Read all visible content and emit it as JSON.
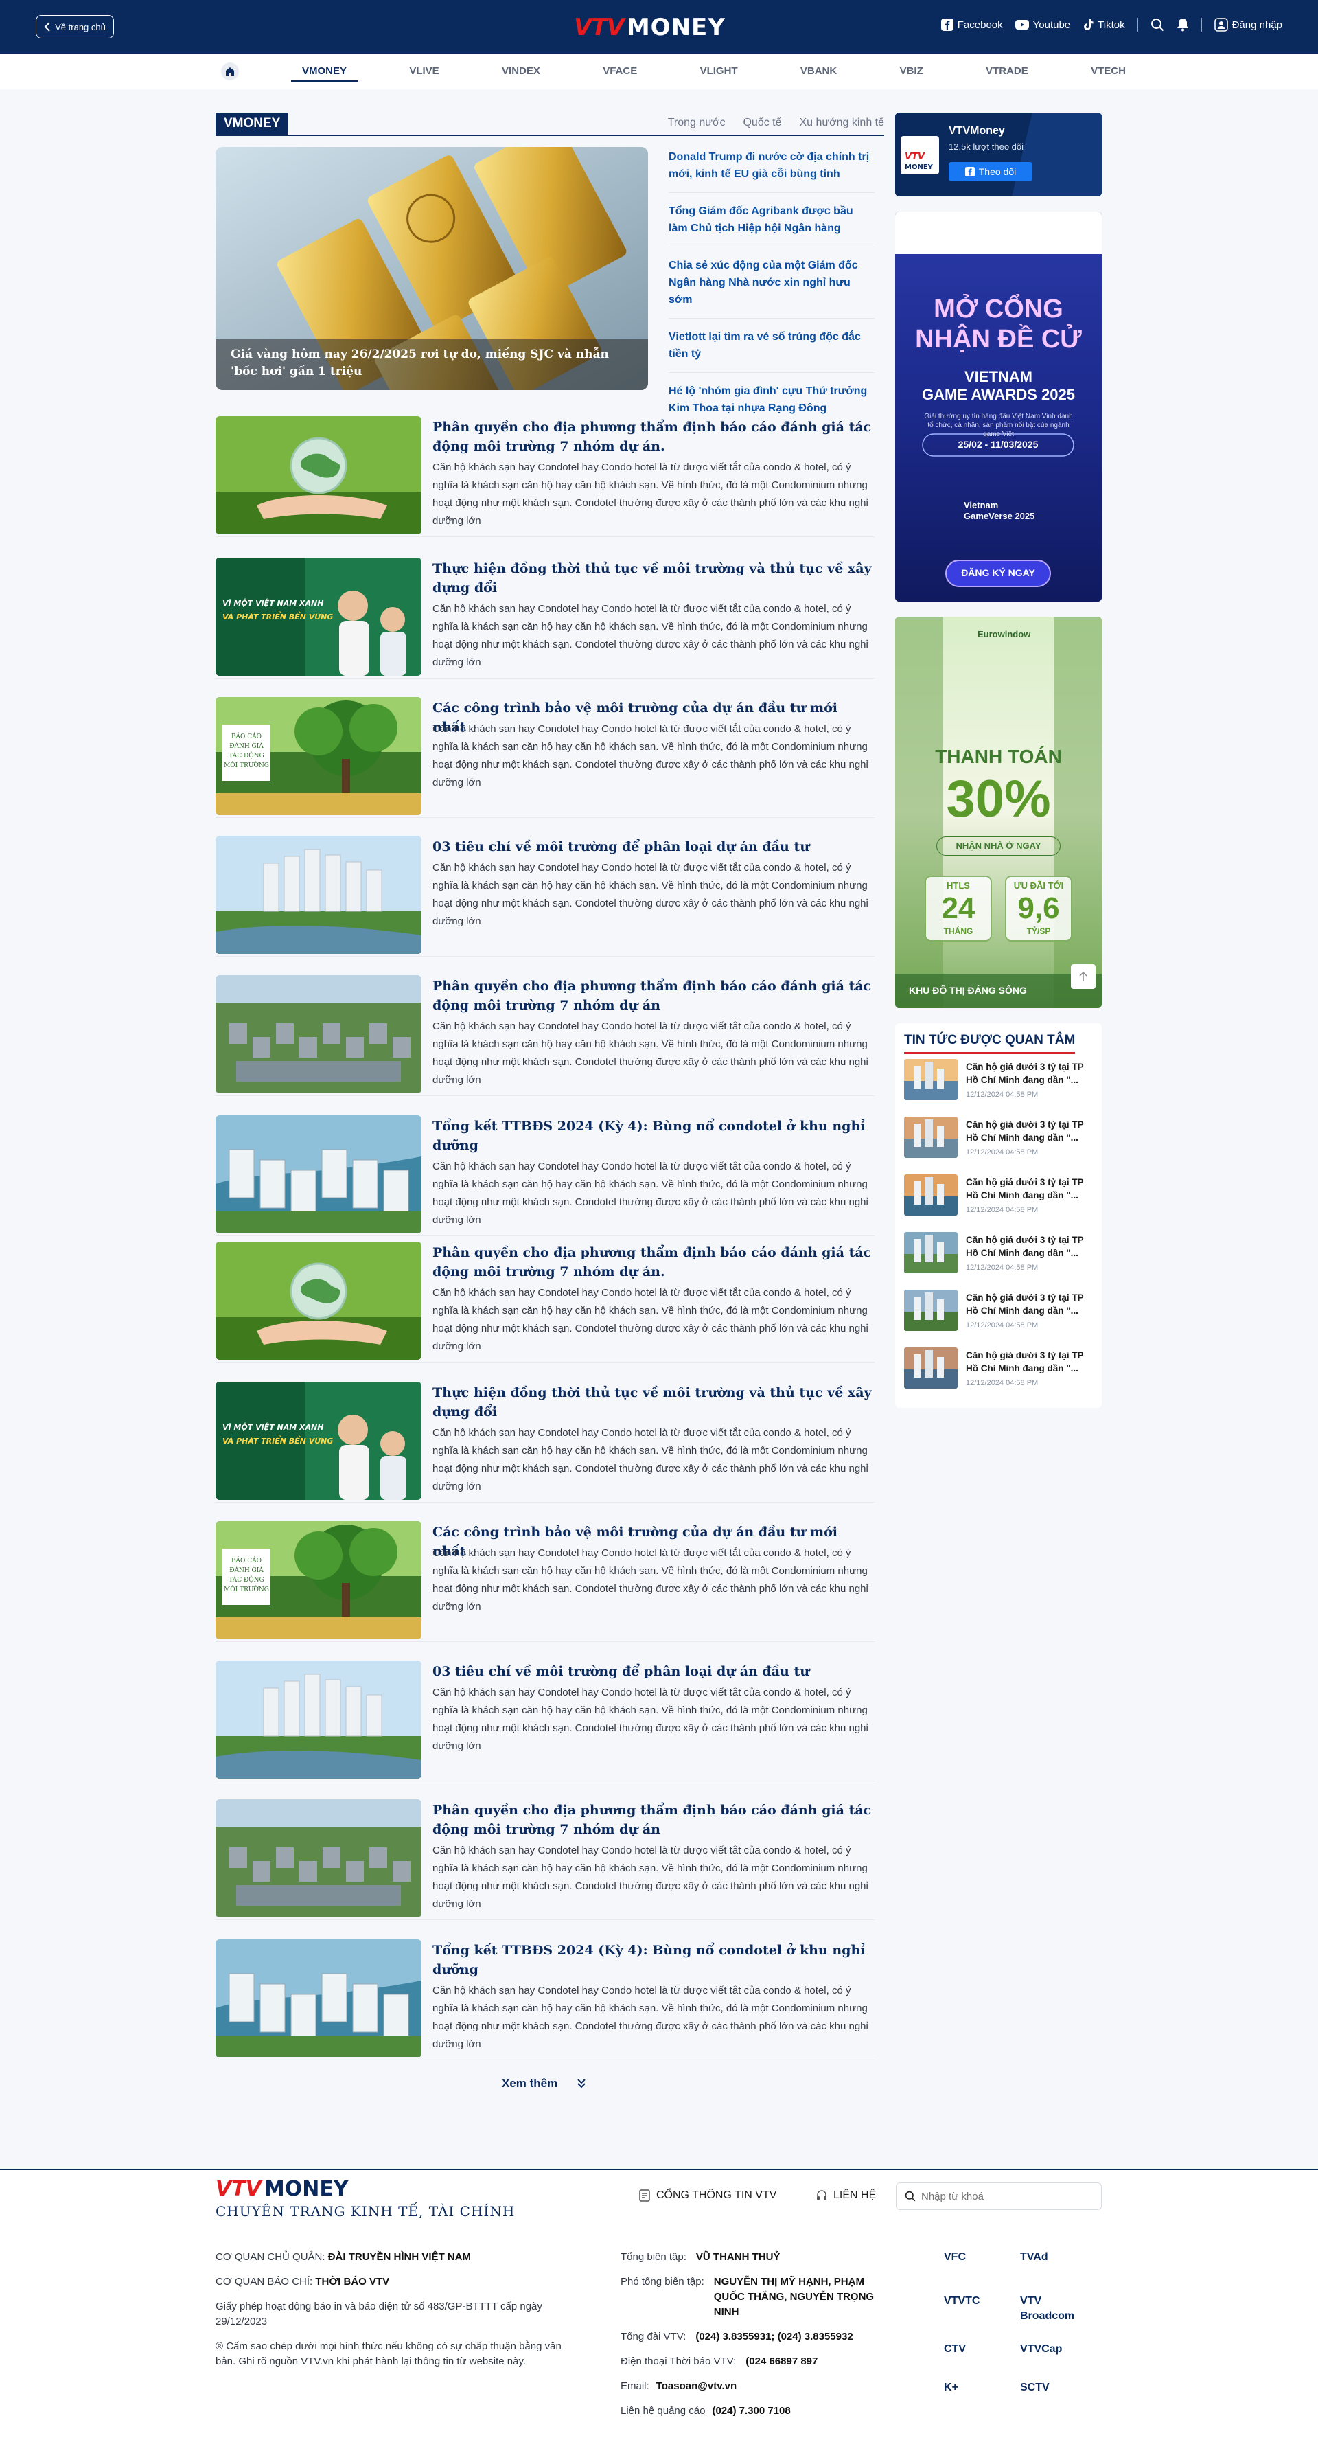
{
  "header": {
    "back_label": "Về trang chủ",
    "logo_vtv": "VTV",
    "logo_money": "MONEY",
    "social": [
      "Facebook",
      "Youtube",
      "Tiktok"
    ],
    "login_label": "Đăng nhập"
  },
  "nav": [
    "VMONEY",
    "VLIVE",
    "VINDEX",
    "VFACE",
    "VLIGHT",
    "VBANK",
    "VBIZ",
    "VTRADE",
    "VTECH"
  ],
  "section": {
    "tag": "VMONEY",
    "tabs": [
      "Trong nước",
      "Quốc tế",
      "Xu hướng kinh tế"
    ]
  },
  "hero": {
    "caption": "Giá vàng hôm nay 26/2/2025 rơi tự do, miếng SJC và nhẫn 'bốc hơi' gần 1 triệu"
  },
  "side_links": [
    "Donald Trump đi nước cờ địa chính trị mới, kinh tế EU già cỗi bùng tỉnh",
    "Tổng Giám đốc Agribank được bầu làm Chủ tịch Hiệp hội Ngân hàng",
    "Chia sẻ xúc động của một Giám đốc Ngân hàng Nhà nước xin nghỉ hưu sớm",
    "Vietlott lại tìm ra vé số trúng độc đắc tiền tỷ",
    "Hé lộ 'nhóm gia đình' cựu Thứ trưởng Kim Thoa tại nhựa Rạng Đông"
  ],
  "article_desc": "Căn hộ khách sạn hay Condotel hay Condo hotel là từ được viết tắt của condo & hotel, có ý nghĩa là khách sạn căn hộ hay căn hộ khách sạn. Về hình thức, đó là một Condominium nhưng hoạt động như một khách sạn. Condotel thường được xây ở các thành phố lớn và các khu nghỉ dưỡng lớn",
  "articles": [
    {
      "title": "Phân quyền cho địa phương thẩm định báo cáo đánh giá tác động môi trường 7 nhóm dự án.",
      "img": "globe"
    },
    {
      "title": "Thực hiện đồng thời thủ tục về môi trường và thủ tục về xây dựng đổi",
      "img": "green-people"
    },
    {
      "title": "Các công trình bảo vệ môi trường của dự án đầu tư mới nhất",
      "img": "tree"
    },
    {
      "title": "03 tiêu chí về môi trường để phân loại dự án đầu tư",
      "img": "city"
    },
    {
      "title": "Phân quyền cho địa phương thẩm định báo cáo đánh giá tác động môi trường 7 nhóm dự án",
      "img": "industrial"
    },
    {
      "title": "Tổng kết TTBĐS 2024 (Kỳ 4): Bùng nổ condotel ở khu nghỉ dưỡng",
      "img": "resort"
    },
    {
      "title": "Phân quyền cho địa phương thẩm định báo cáo đánh giá tác động môi trường 7 nhóm dự án.",
      "img": "globe"
    },
    {
      "title": "Thực hiện đồng thời thủ tục về môi trường và thủ tục về xây dựng đổi",
      "img": "green-people"
    },
    {
      "title": "Các công trình bảo vệ môi trường của dự án đầu tư mới nhất",
      "img": "tree"
    },
    {
      "title": "03 tiêu chí về môi trường để phân loại dự án đầu tư",
      "img": "city"
    },
    {
      "title": "Phân quyền cho địa phương thẩm định báo cáo đánh giá tác động môi trường 7 nhóm dự án",
      "img": "industrial"
    },
    {
      "title": "Tổng kết TTBĐS 2024 (Kỳ 4): Bùng nổ condotel ở khu nghỉ dưỡng",
      "img": "resort"
    }
  ],
  "image_texts": {
    "green_banner": "VÌ MỘT VIỆT NAM XANH VÀ PHÁT TRIỂN BỀN VỮNG",
    "tree_sign": "BÁO CÁO ĐÁNH GIÁ TÁC ĐỘNG MÔI TRƯỜNG"
  },
  "more_label": "Xem thêm",
  "fanpage": {
    "name": "VTVMoney",
    "followers": "12.5k lượt theo dõi",
    "follow_label": "Theo dõi"
  },
  "ad1": {
    "headline1": "MỞ CỔNG",
    "headline2": "NHẬN ĐỀ CỬ",
    "event1": "VIETNAM",
    "event2": "GAME AWARDS 2025",
    "desc": "Giải thưởng uy tín hàng đầu Việt Nam Vinh danh tổ chức, cá nhân, sản phẩm nổi bật của ngành game Việt",
    "dates": "25/02 - 11/03/2025",
    "org": "Vietnam GameVerse 2025",
    "cta": "ĐĂNG KÝ NGAY"
  },
  "ad2": {
    "brand": "Eurowindow",
    "headline": "THANH TOÁN",
    "percent": "30%",
    "sub": "NHẬN NHÀ Ở NGAY",
    "box1_label": "HTLS",
    "box1_value": "24",
    "box1_unit": "THÁNG",
    "box2_label": "ƯU ĐÃI TỚI",
    "box2_value": "9,6",
    "box2_unit": "TỶ/SP",
    "footer": "KHU ĐÔ THỊ ĐÁNG SỐNG"
  },
  "related": {
    "title": "TIN TỨC ĐƯỢC QUAN TÂM",
    "items": [
      {
        "text": "Căn hộ giá dưới 3 tỷ tại TP Hồ Chí Minh đang dần \"...",
        "time": "12/12/2024 04:58 PM"
      },
      {
        "text": "Căn hộ giá dưới 3 tỷ tại TP Hồ Chí Minh đang dần \"...",
        "time": "12/12/2024 04:58 PM"
      },
      {
        "text": "Căn hộ giá dưới 3 tỷ tại TP Hồ Chí Minh đang dần \"...",
        "time": "12/12/2024 04:58 PM"
      },
      {
        "text": "Căn hộ giá dưới 3 tỷ tại TP Hồ Chí Minh đang dần \"...",
        "time": "12/12/2024 04:58 PM"
      },
      {
        "text": "Căn hộ giá dưới 3 tỷ tại TP Hồ Chí Minh đang dần \"...",
        "time": "12/12/2024 04:58 PM"
      },
      {
        "text": "Căn hộ giá dưới 3 tỷ tại TP Hồ Chí Minh đang dần \"...",
        "time": "12/12/2024 04:58 PM"
      }
    ]
  },
  "footer": {
    "logo_vtv": "VTV",
    "logo_money": "MONEY",
    "tagline": "CHUYÊN TRANG KINH TẾ, TÀI CHÍNH",
    "portal_label": "CỔNG THÔNG TIN VTV",
    "contact_label": "LIÊN HỆ",
    "search_placeholder": "Nhập từ khoá",
    "owner_label": "CƠ QUAN CHỦ QUẢN:",
    "owner_value": "ĐÀI TRUYỀN HÌNH VIỆT NAM",
    "publisher_label": "CƠ QUAN BÁO CHÍ:",
    "publisher_value": "THỜI BÁO VTV",
    "license": "Giấy phép hoạt động báo in và báo điện tử số 483/GP-BTTTT cấp ngày 29/12/2023",
    "copyright": "® Cấm sao chép dưới mọi hình thức nếu không có sự chấp thuận bằng văn bản. Ghi rõ nguồn VTV.vn khi phát hành lại thông tin từ website này.",
    "editor_label": "Tổng biên tập:",
    "editor_value": "VŨ THANH THUỶ",
    "deputy_label": "Phó tổng biên tập:",
    "deputy_value": "NGUYỄN THỊ MỸ HẠNH, PHẠM QUỐC THẮNG, NGUYỄN TRỌNG NINH",
    "hotline_label": "Tổng đài VTV:",
    "hotline_value": "(024) 3.8355931; (024) 3.8355932",
    "phone_label": "Điện thoại Thời báo VTV:",
    "phone_value": "(024 66897 897",
    "email_label": "Email:",
    "email_value": "Toasoan@vtv.vn",
    "ads_label": "Liên hệ quảng cáo",
    "ads_value": "(024) 7.300 7108",
    "partners": [
      "VFC",
      "TVAd",
      "VTVTC",
      "VTV Broadcom",
      "CTV",
      "VTVCap",
      "K+",
      "SCTV"
    ]
  },
  "colors": {
    "primary": "#0a2a5e",
    "accent": "#e31d1d",
    "link": "#0a4fa3"
  }
}
